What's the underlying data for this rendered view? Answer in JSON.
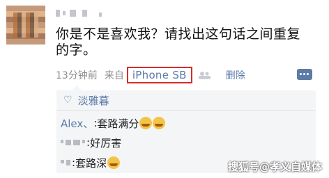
{
  "post": {
    "text": "你是不是喜欢我？请找出这句话之间重复的字。",
    "time": "13分钟前",
    "via_label": "来自",
    "device": "iPhone SB",
    "delete_label": "删除"
  },
  "likes": {
    "names": "淡雅暮"
  },
  "comments": [
    {
      "author": "Alex、",
      "sep": ":",
      "text": "套路满分"
    },
    {
      "author": "",
      "sep": ":",
      "text": "好厉害"
    },
    {
      "author": "",
      "sep": ":",
      "text": "套路深"
    }
  ],
  "icons": {
    "heart": "heart-icon",
    "people": "people-icon",
    "comment": "comment-icon"
  },
  "colors": {
    "link": "#5a7aa8",
    "highlight_box": "#d92a2a",
    "comment_bg": "#f4f5f7"
  },
  "watermark": "搜狐号@孝义自媒体"
}
